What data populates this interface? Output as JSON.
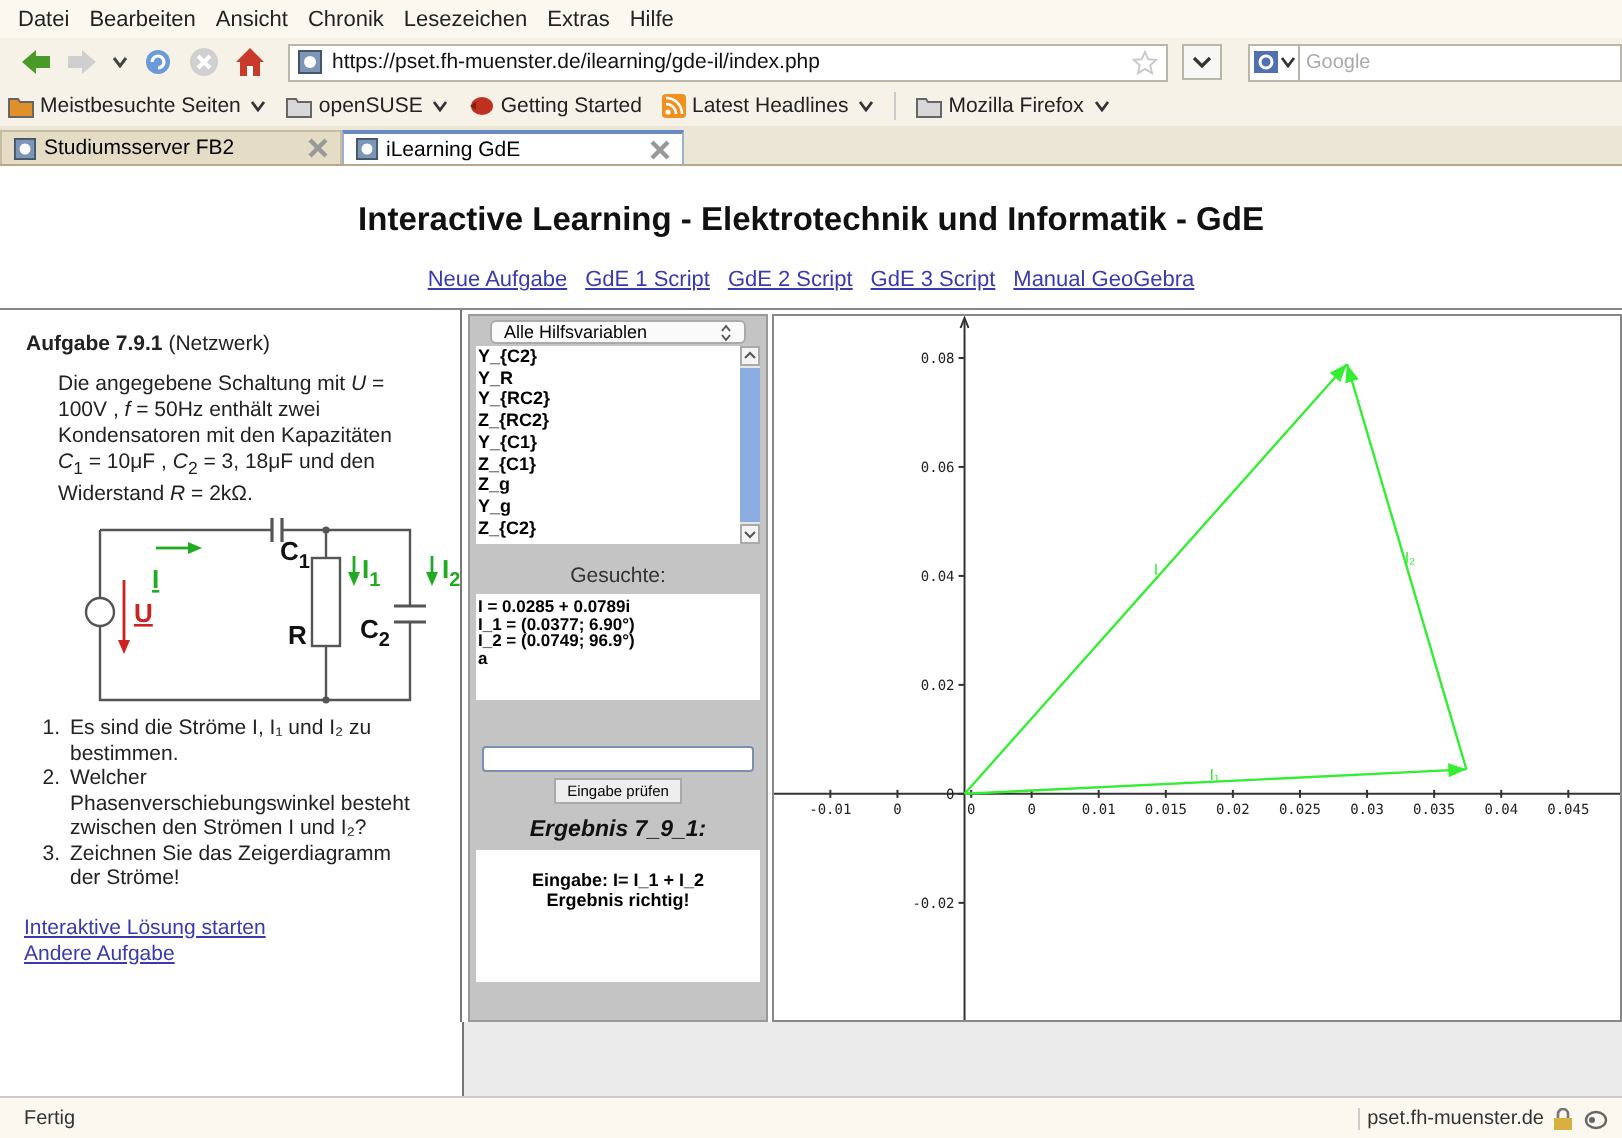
{
  "menu": [
    {
      "label": "Datei"
    },
    {
      "label": "Bearbeiten"
    },
    {
      "label": "Ansicht"
    },
    {
      "label": "Chronik"
    },
    {
      "label": "Lesezeichen"
    },
    {
      "label": "Extras"
    },
    {
      "label": "Hilfe"
    }
  ],
  "navigation": {
    "url": "https://pset.fh-muenster.de/ilearning/gde-il/index.php",
    "search_placeholder": "Google"
  },
  "bookmarks": [
    {
      "label": "Meistbesuchte Seiten",
      "kind": "folder-orange",
      "menu": true
    },
    {
      "label": "openSUSE",
      "kind": "folder",
      "menu": true
    },
    {
      "label": "Getting Started",
      "kind": "page",
      "menu": false
    },
    {
      "label": "Latest Headlines",
      "kind": "feed",
      "menu": true
    },
    {
      "label": "Mozilla Firefox",
      "kind": "folder",
      "menu": true
    }
  ],
  "tabs": [
    {
      "label": "Studiumsserver FB2",
      "selected": false
    },
    {
      "label": "iLearning GdE",
      "selected": true
    }
  ],
  "page": {
    "title": "Interactive Learning - Elektrotechnik und Informatik - GdE",
    "links": [
      "Neue Aufgabe",
      "GdE 1 Script",
      "GdE 2 Script",
      "GdE 3 Script",
      "Manual GeoGebra"
    ],
    "task": {
      "heading": "**Aufgabe 7.9.1** (Netzwerk)",
      "description": "Die angegebene Schaltung mit *U* = 100V , *f* = 50Hz enthält zwei Kondensatoren mit den Kapazitäten *C*$_{1}$ = 10μF , *C*$_{2}$ = 3, 18μF und den Widerstand *R* = 2kΩ.",
      "circuit_labels": [
        {
          "text": "C",
          "sub": "1",
          "color": "#111111"
        },
        {
          "text": "R",
          "color": "#111111"
        },
        {
          "text": "C",
          "sub": "2",
          "color": "#111111"
        },
        {
          "text": "I",
          "color": "#22aa22"
        },
        {
          "text": "U",
          "color": "#cc2222"
        },
        {
          "text": "I",
          "sub": "1",
          "color": "#22aa22"
        },
        {
          "text": "I",
          "sub": "2",
          "color": "#22aa22"
        }
      ],
      "questions": [
        {
          "number": "1.",
          "text": "Es sind die Ströme I, I₁ und I₂ zu bestimmen."
        },
        {
          "number": "2.",
          "text": "Welcher Phasenverschiebungswinkel besteht zwischen den Strömen I und I₂?"
        },
        {
          "number": "3.",
          "text": "Zeichnen Sie das Zeigerdiagramm der Ströme!"
        }
      ],
      "links": [
        "Interaktive Lösung starten",
        "Andere Aufgabe"
      ]
    },
    "tool": {
      "variable_select": "Alle Hilfsvariablen",
      "variables": [
        "Y_{C2}",
        "Y_R",
        "Y_{RC2}",
        "Z_{RC2}",
        "Y_{C1}",
        "Z_{C1}",
        "Z_g",
        "Y_g",
        "Z_{C2}"
      ],
      "sought_label": "Gesuchte:",
      "sought": [
        "I = 0.0285 + 0.0789i",
        "I_1 = (0.0377; 6.90°)",
        "I_2 = (0.0749; 96.9°)",
        "a"
      ],
      "check_button": "Eingabe prüfen",
      "result_title": "Ergebnis 7_9_1:",
      "result_lines": [
        "Eingabe: I= I_1 + I_2",
        "Ergebnis richtig!"
      ]
    },
    "chart_data": {
      "type": "line",
      "x": [
        0,
        0.0374,
        0.0285
      ],
      "series": [
        {
          "name": "I",
          "color": "#33ee33",
          "values": [
            0,
            null,
            0.0789
          ]
        },
        {
          "name": "I₁",
          "color": "#33ee33",
          "values": [
            0,
            0.0045,
            null
          ]
        },
        {
          "name": "I₂",
          "color": "#33ee33",
          "values": [
            null,
            0.0045,
            0.0789
          ]
        }
      ],
      "xlim": [
        -0.0142,
        0.049
      ],
      "ylim": [
        -0.0415,
        0.0877
      ],
      "xticks": [
        -0.01,
        {
          "value": -0.005,
          "label": "0"
        },
        {
          "value": 0.0005,
          "label": "0"
        },
        {
          "value": 0.005,
          "label": "0"
        },
        0.01,
        0.015,
        0.02,
        0.025,
        0.03,
        0.035,
        0.04,
        0.045
      ],
      "yticks": [
        -0.02,
        {
          "value": 0,
          "label": "0"
        },
        0.02,
        0.04,
        0.06,
        0.08
      ]
    }
  },
  "status_bar": {
    "text": "Fertig",
    "host": "pset.fh-muenster.de"
  }
}
